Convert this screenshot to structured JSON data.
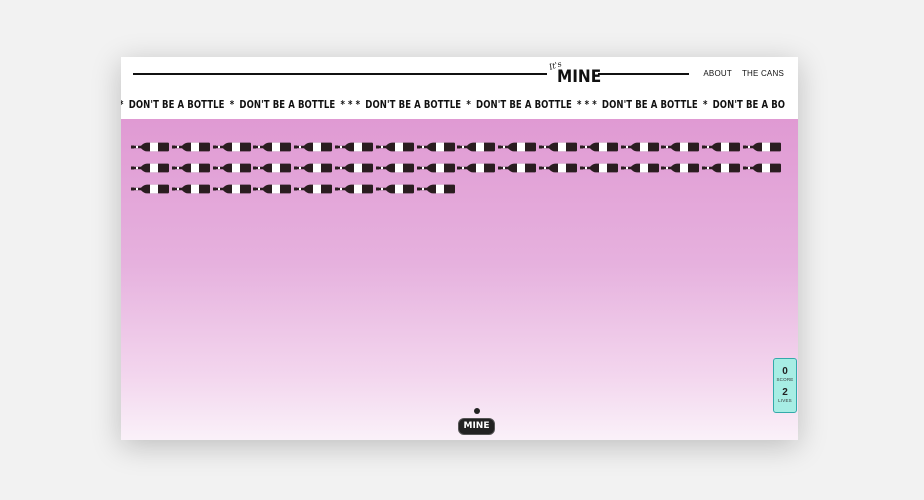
{
  "header": {
    "logo_script": "It's",
    "logo_word": "MINE",
    "nav": [
      "ABOUT",
      "THE CANS"
    ]
  },
  "ticker": {
    "items": [
      {
        "star": "*",
        "text": "DON'T BE A BOTTLE"
      },
      {
        "star": "*",
        "text": "DON'T BE A BOTTLE"
      },
      {
        "star": "* * *",
        "text": "DON'T BE A BOTTLE"
      },
      {
        "star": "*",
        "text": "DON'T BE A BOTTLE"
      },
      {
        "star": "* * *",
        "text": "DON'T BE A BOTTLE"
      },
      {
        "star": "*",
        "text": "DON'T BE A BO"
      }
    ]
  },
  "game": {
    "bottle_rows": [
      16,
      16,
      8
    ],
    "paddle_label": "MINE",
    "colors": {
      "bottle": "#2a1d20",
      "label": "#ffffff",
      "bg_top": "#e09ad3",
      "bg_bottom": "#faf1f9",
      "scorebox": "#a7ede4"
    }
  },
  "score": {
    "score_value": "0",
    "score_label": "SCORE",
    "lives_value": "2",
    "lives_label": "LIVES"
  }
}
